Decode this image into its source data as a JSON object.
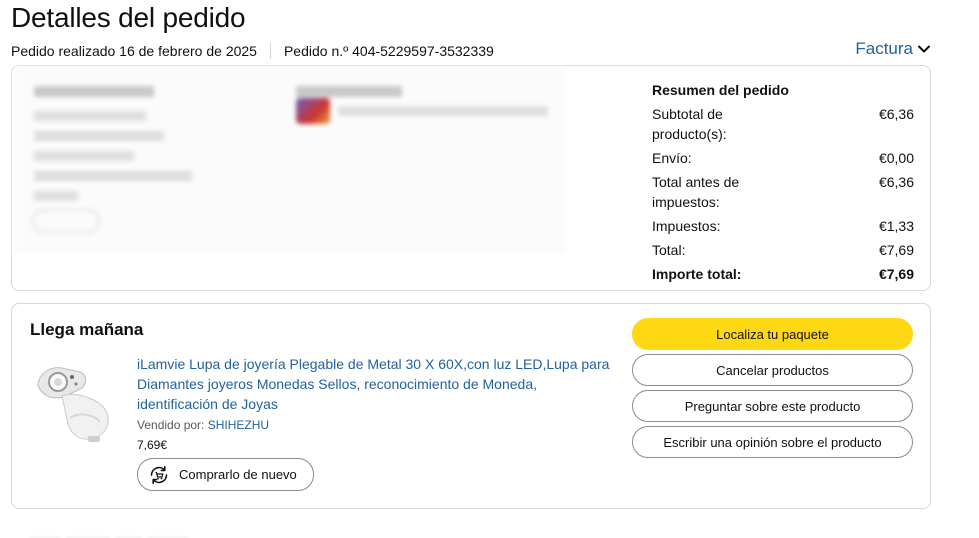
{
  "page_title": "Detalles del pedido",
  "order": {
    "placed": "Pedido realizado 16 de febrero de 2025",
    "number": "Pedido n.º 404-5229597-3532339"
  },
  "invoice_label": "Factura",
  "summary": {
    "title": "Resumen del pedido",
    "rows": [
      {
        "label": "Subtotal de producto(s):",
        "value": "€6,36"
      },
      {
        "label": "Envío:",
        "value": "€0,00"
      },
      {
        "label": "Total antes de impuestos:",
        "value": "€6,36"
      },
      {
        "label": "Impuestos:",
        "value": "€1,33"
      },
      {
        "label": "Total:",
        "value": "€7,69"
      },
      {
        "label": "Importe total:",
        "value": "€7,69"
      }
    ]
  },
  "shipment": {
    "title": "Llega mañana",
    "product_title": "iLamvie Lupa de joyería Plegable de Metal 30 X 60X,con luz LED,Lupa para Diamantes joyeros Monedas Sellos, reconocimiento de Moneda, identificación de Joyas",
    "sold_by_label": "Vendido por:",
    "seller": "SHIHEZHU",
    "price": "7,69€",
    "buy_again": "Comprarlo de nuevo",
    "actions": {
      "track": "Localiza tu paquete",
      "cancel": "Cancelar productos",
      "ask": "Preguntar sobre este producto",
      "review": "Escribir una opinión sobre el producto"
    }
  },
  "colors": {
    "link": "#2162a1",
    "primary_button": "#ffd814",
    "border": "#d5d9d9"
  }
}
